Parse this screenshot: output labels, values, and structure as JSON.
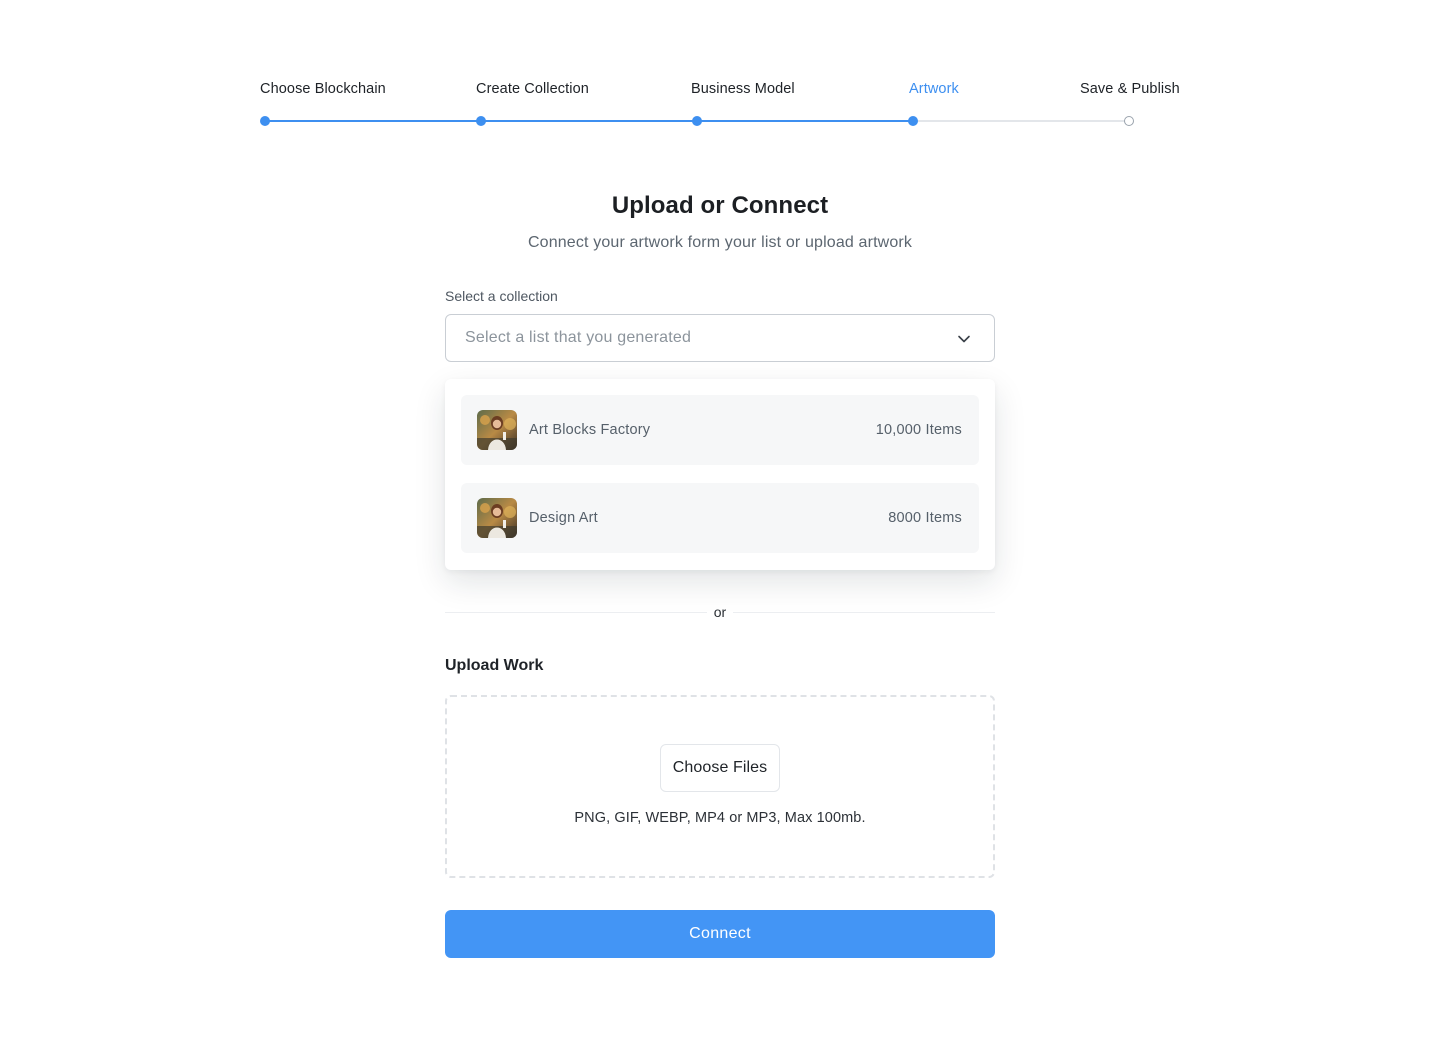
{
  "stepper": {
    "steps": [
      {
        "label": "Choose Blockchain",
        "state": "complete"
      },
      {
        "label": "Create Collection",
        "state": "complete"
      },
      {
        "label": "Business Model",
        "state": "complete"
      },
      {
        "label": "Artwork",
        "state": "active"
      },
      {
        "label": "Save & Publish",
        "state": "upcoming"
      }
    ]
  },
  "header": {
    "title": "Upload or Connect",
    "subtitle": "Connect your artwork form your list or upload artwork"
  },
  "collection_select": {
    "label": "Select a collection",
    "placeholder": "Select a list that you generated",
    "icon": "chevron-down-icon",
    "options": [
      {
        "name": "Art Blocks Factory",
        "count": "10,000 Items"
      },
      {
        "name": "Design Art",
        "count": "8000 Items"
      }
    ]
  },
  "divider": {
    "text": "or"
  },
  "upload": {
    "title": "Upload Work",
    "button_label": "Choose Files",
    "hint": "PNG, GIF, WEBP, MP4 or MP3, Max 100mb."
  },
  "connect": {
    "label": "Connect"
  },
  "colors": {
    "accent": "#4395f5",
    "step_active": "#3d8ff0",
    "track_inactive": "#e3e6ea"
  }
}
